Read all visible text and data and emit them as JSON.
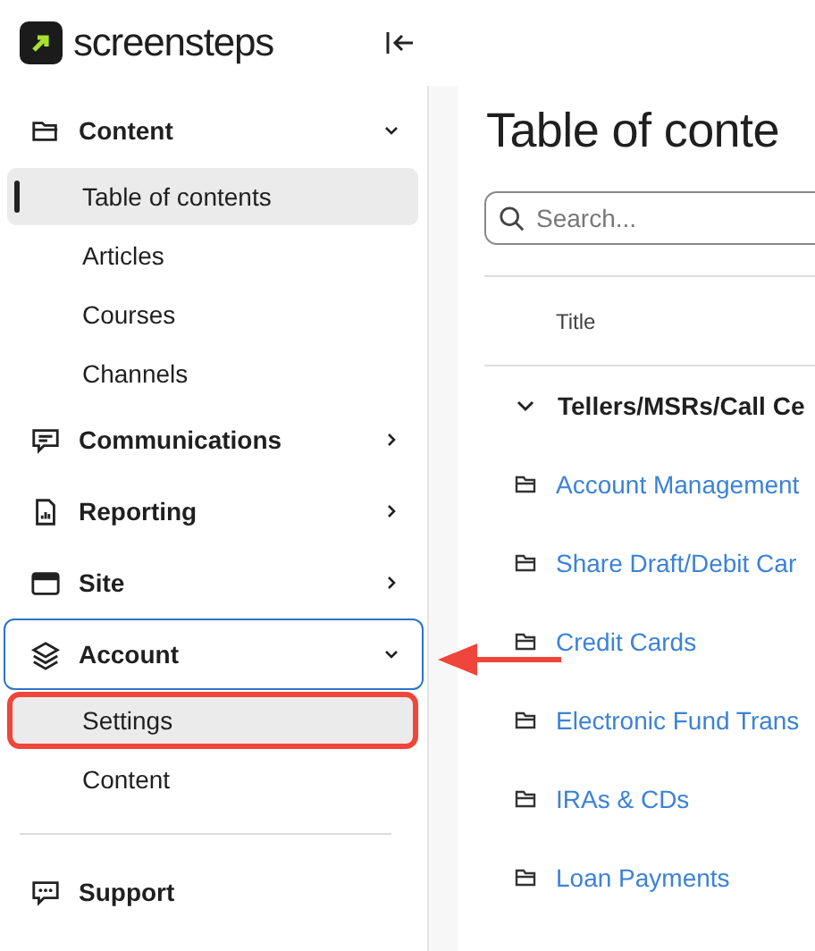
{
  "brand": {
    "name": "screensteps"
  },
  "sidebar": {
    "sections": [
      {
        "kind": "group",
        "label": "Content",
        "expanded": true,
        "focused": false,
        "children": [
          {
            "label": "Table of contents",
            "selected": true,
            "highlighted": false
          },
          {
            "label": "Articles",
            "selected": false,
            "highlighted": false
          },
          {
            "label": "Courses",
            "selected": false,
            "highlighted": false
          },
          {
            "label": "Channels",
            "selected": false,
            "highlighted": false
          }
        ]
      },
      {
        "kind": "group",
        "label": "Communications",
        "expanded": false,
        "focused": false
      },
      {
        "kind": "group",
        "label": "Reporting",
        "expanded": false,
        "focused": false
      },
      {
        "kind": "group",
        "label": "Site",
        "expanded": false,
        "focused": false
      },
      {
        "kind": "group",
        "label": "Account",
        "expanded": true,
        "focused": true,
        "children": [
          {
            "label": "Settings",
            "selected": false,
            "highlighted": true
          },
          {
            "label": "Content",
            "selected": false,
            "highlighted": false
          }
        ]
      },
      {
        "kind": "divider"
      },
      {
        "kind": "link",
        "label": "Support"
      }
    ]
  },
  "main": {
    "title": "Table of conte",
    "search": {
      "placeholder": "Search..."
    },
    "table": {
      "columns": [
        "Title"
      ],
      "rows": [
        {
          "kind": "group",
          "title": "Tellers/MSRs/Call Ce",
          "expanded": true
        },
        {
          "kind": "folder",
          "title": "Account Management"
        },
        {
          "kind": "folder",
          "title": "Share Draft/Debit Car"
        },
        {
          "kind": "folder",
          "title": "Credit Cards"
        },
        {
          "kind": "folder",
          "title": "Electronic Fund Trans"
        },
        {
          "kind": "folder",
          "title": "IRAs & CDs"
        },
        {
          "kind": "folder",
          "title": "Loan Payments"
        }
      ]
    }
  }
}
